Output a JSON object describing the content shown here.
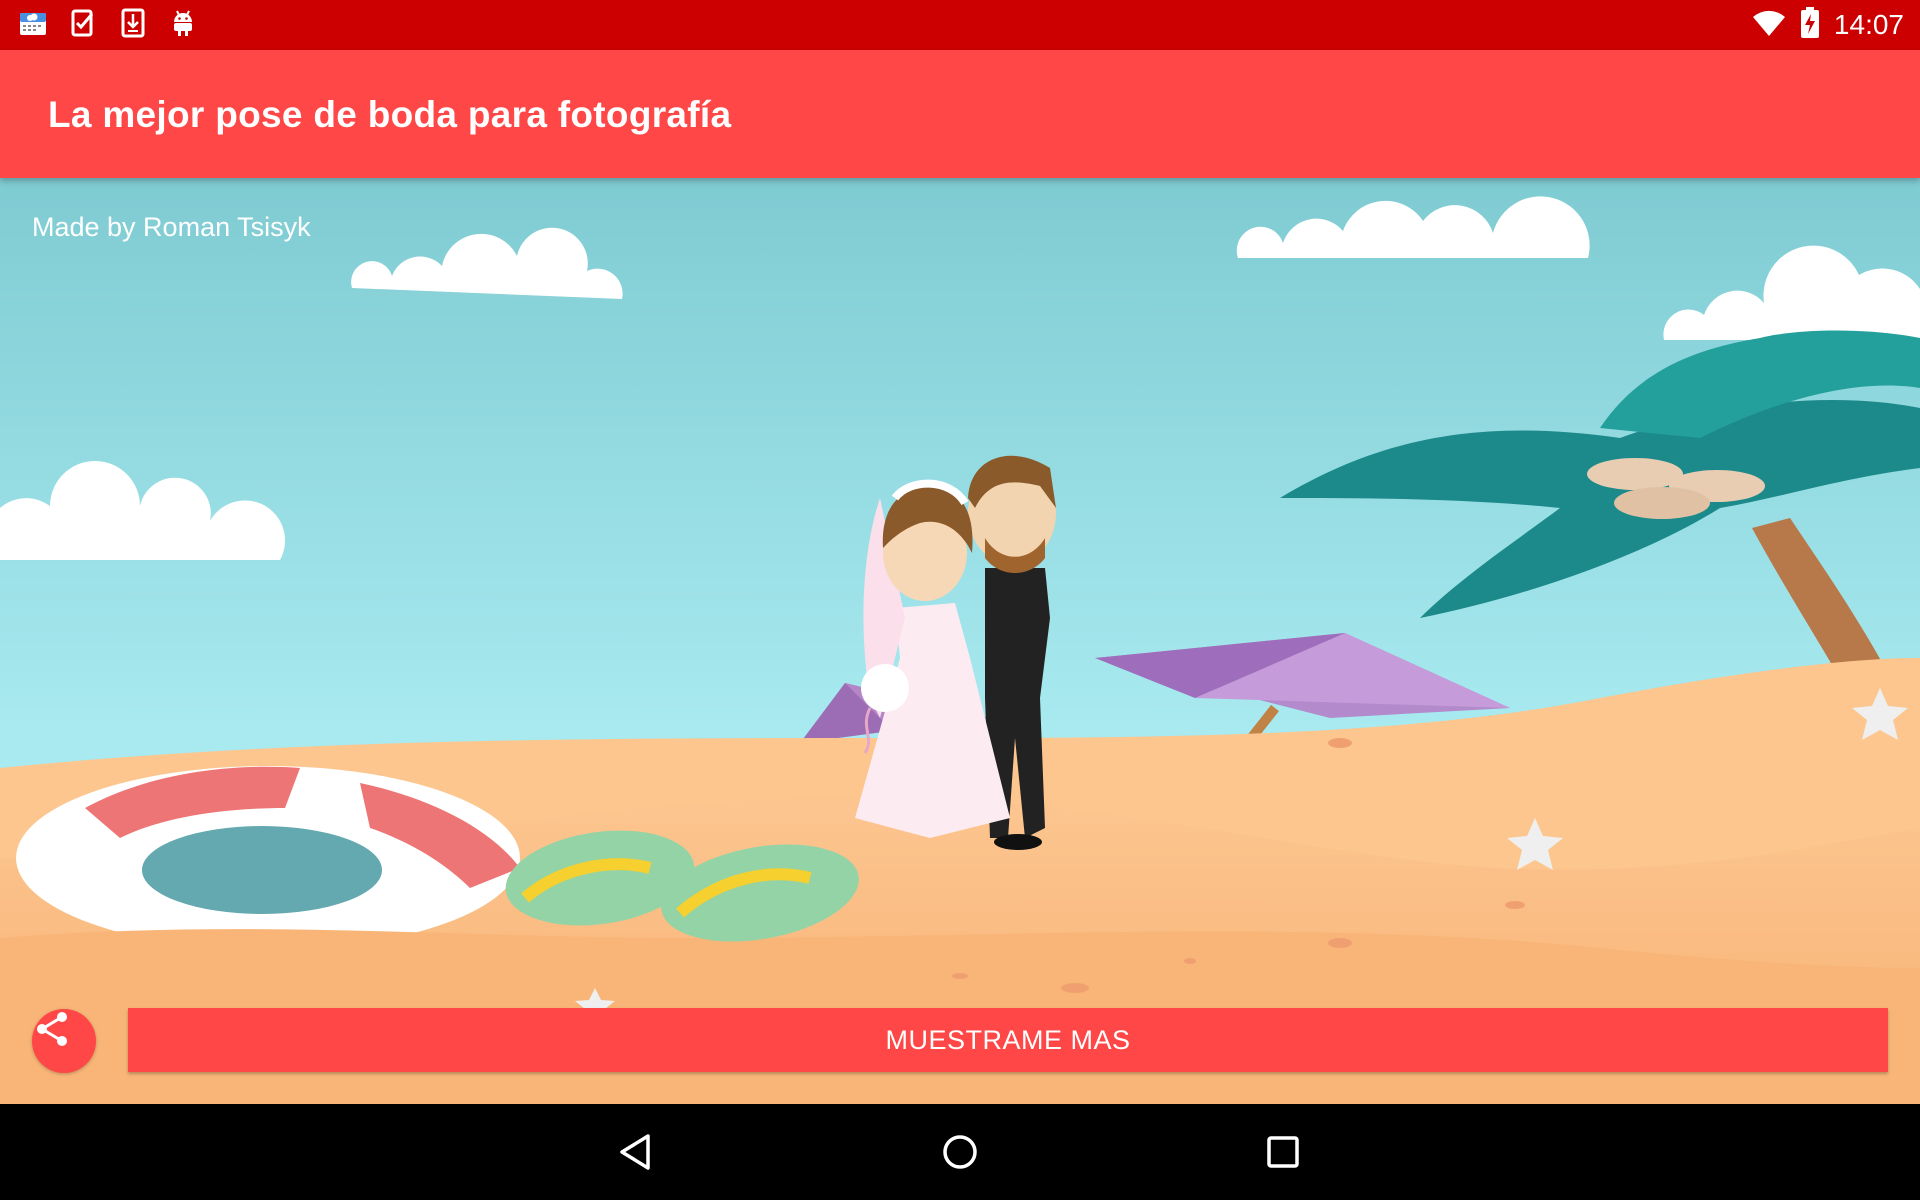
{
  "status_bar": {
    "time": "14:07",
    "left_icons": [
      "weather-app-icon",
      "task-check-icon",
      "download-icon",
      "android-icon"
    ],
    "right_icons": [
      "wifi-icon",
      "battery-charging-icon"
    ]
  },
  "app_bar": {
    "title": "La mejor pose de boda para fotografía"
  },
  "content": {
    "credit": "Made by Roman Tsisyk",
    "show_more_label": "MUESTRAME MAS",
    "share_icon": "share-icon"
  },
  "nav_bar": {
    "icons": [
      "back-icon",
      "home-icon",
      "recents-icon"
    ]
  },
  "colors": {
    "status_bar": "#CC0000",
    "accent": "#FF4747",
    "sky": "#8ED8DF",
    "sand": "#F9B97A"
  }
}
